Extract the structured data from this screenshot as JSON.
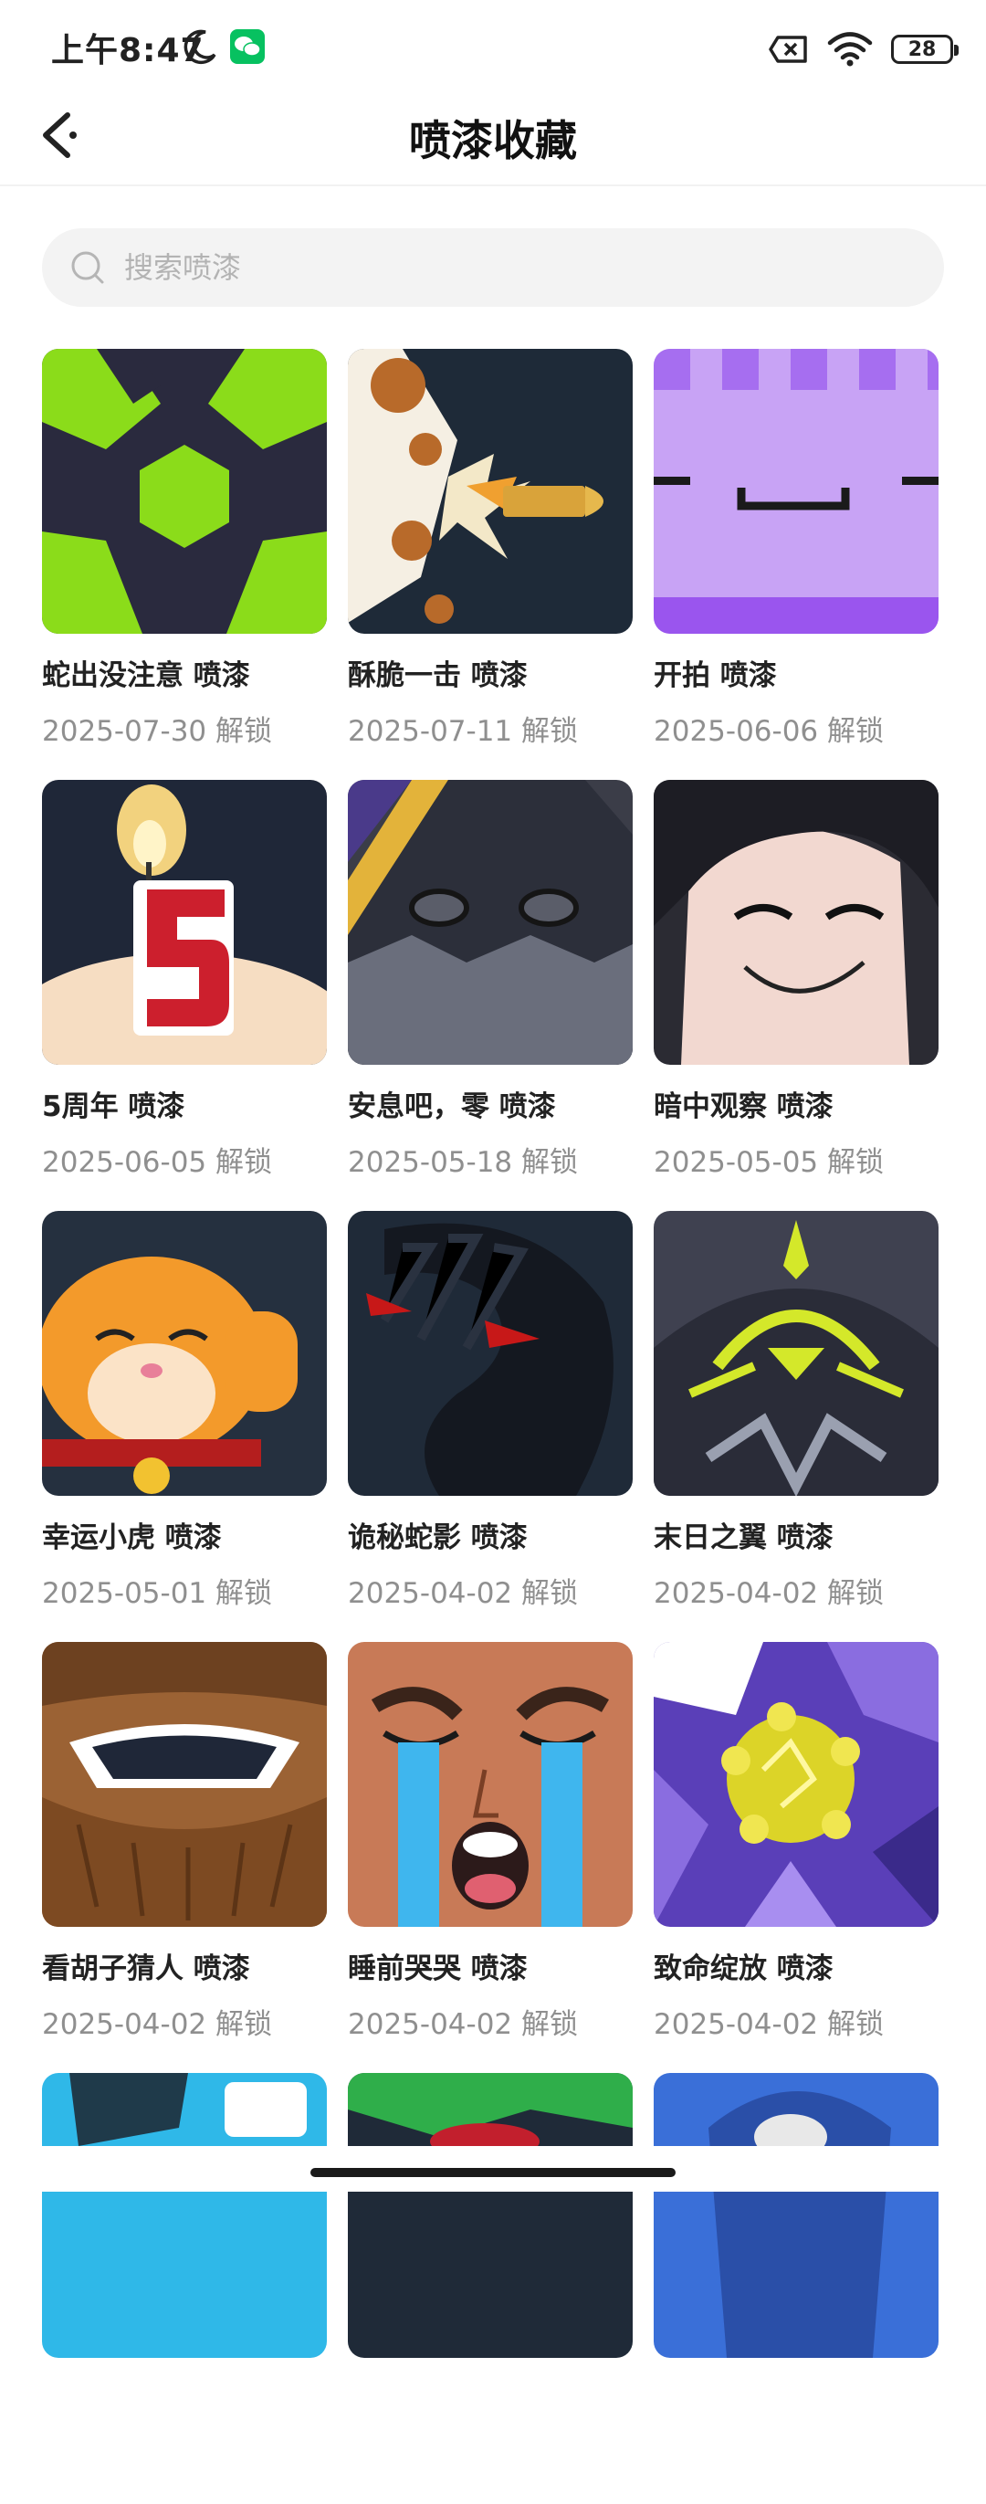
{
  "status_bar": {
    "time": "上午8:47",
    "battery": "28"
  },
  "header": {
    "title": "喷漆收藏"
  },
  "search": {
    "placeholder": "搜索喷漆"
  },
  "items": [
    {
      "name": "蛇出没注意 喷漆",
      "date": "2025-07-30 解锁"
    },
    {
      "name": "酥脆一击 喷漆",
      "date": "2025-07-11 解锁"
    },
    {
      "name": "开拍 喷漆",
      "date": "2025-06-06 解锁"
    },
    {
      "name": "5周年 喷漆",
      "date": "2025-06-05 解锁"
    },
    {
      "name": "安息吧，零 喷漆",
      "date": "2025-05-18 解锁"
    },
    {
      "name": "暗中观察 喷漆",
      "date": "2025-05-05 解锁"
    },
    {
      "name": "幸运小虎 喷漆",
      "date": "2025-05-01 解锁"
    },
    {
      "name": "诡秘蛇影 喷漆",
      "date": "2025-04-02 解锁"
    },
    {
      "name": "末日之翼 喷漆",
      "date": "2025-04-02 解锁"
    },
    {
      "name": "看胡子猜人 喷漆",
      "date": "2025-04-02 解锁"
    },
    {
      "name": "睡前哭哭 喷漆",
      "date": "2025-04-02 解锁"
    },
    {
      "name": "致命绽放 喷漆",
      "date": "2025-04-02 解锁"
    }
  ],
  "icons": {
    "back": "back-arrow-icon",
    "search": "search-icon",
    "moon": "moon-icon",
    "wechat": "wechat-icon",
    "sim": "no-sim-icon",
    "wifi": "wifi-icon",
    "battery": "battery-icon"
  },
  "colors": {
    "accent_green": "#07c160",
    "text_primary": "#222222",
    "text_secondary": "#8f8f8f",
    "search_bg": "#f3f3f3"
  }
}
